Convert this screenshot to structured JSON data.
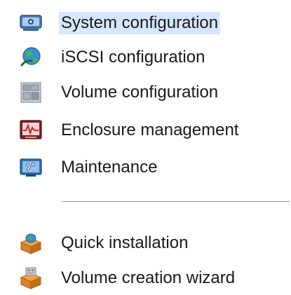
{
  "menu": {
    "items": [
      {
        "label": "System configuration",
        "icon": "system-configuration-icon",
        "selected": true
      },
      {
        "label": "iSCSI configuration",
        "icon": "iscsi-configuration-icon",
        "selected": false
      },
      {
        "label": "Volume configuration",
        "icon": "volume-configuration-icon",
        "selected": false
      },
      {
        "label": "Enclosure management",
        "icon": "enclosure-management-icon",
        "selected": false
      },
      {
        "label": "Maintenance",
        "icon": "maintenance-icon",
        "selected": false
      }
    ],
    "quick_items": [
      {
        "label": "Quick installation",
        "icon": "quick-installation-icon"
      },
      {
        "label": "Volume creation wizard",
        "icon": "volume-creation-wizard-icon"
      }
    ]
  },
  "colors": {
    "selection_background": "#d6e6fb",
    "separator": "#9a9a9a",
    "text": "#1a1a1a"
  }
}
